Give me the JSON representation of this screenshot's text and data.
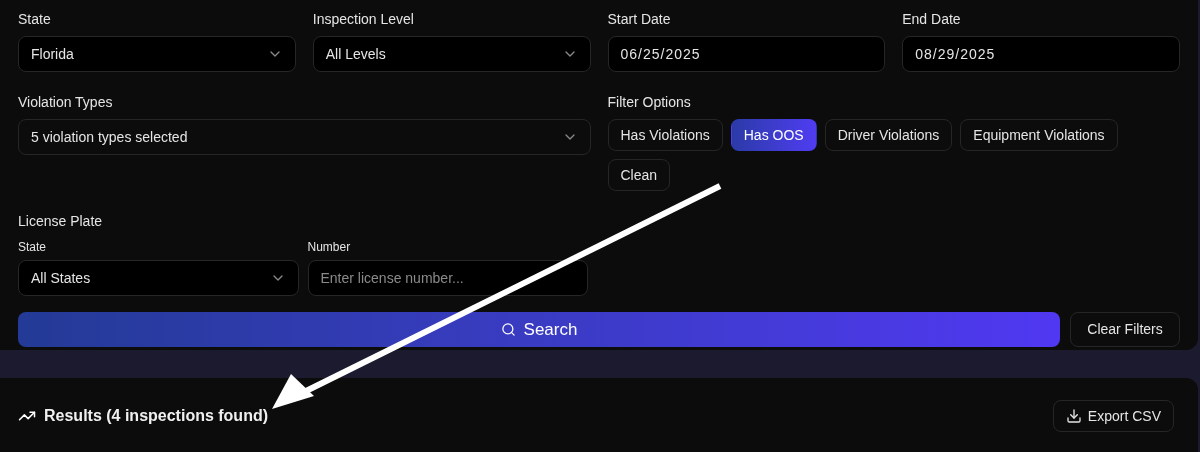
{
  "filters": {
    "top_fields": [
      {
        "kind": "select",
        "label": "State",
        "value": "Florida"
      },
      {
        "kind": "select",
        "label": "Inspection Level",
        "value": "All Levels"
      },
      {
        "kind": "date",
        "label": "Start Date",
        "value": "06/25/2025"
      },
      {
        "kind": "date",
        "label": "End Date",
        "value": "08/29/2025"
      }
    ],
    "violation_types": {
      "label": "Violation Types",
      "value": "5 violation types selected"
    },
    "filter_options": {
      "label": "Filter Options",
      "options": [
        {
          "label": "Has Violations",
          "selected": false
        },
        {
          "label": "Has OOS",
          "selected": true
        },
        {
          "label": "Driver Violations",
          "selected": false
        },
        {
          "label": "Equipment Violations",
          "selected": false
        },
        {
          "label": "Clean",
          "selected": false
        }
      ]
    },
    "license_plate": {
      "label": "License Plate",
      "state": {
        "label": "State",
        "value": "All States"
      },
      "number": {
        "label": "Number",
        "placeholder": "Enter license number..."
      }
    },
    "search_button": "Search",
    "clear_button": "Clear Filters"
  },
  "results": {
    "title": "Results (4 inspections found)",
    "export_button": "Export CSV"
  }
}
